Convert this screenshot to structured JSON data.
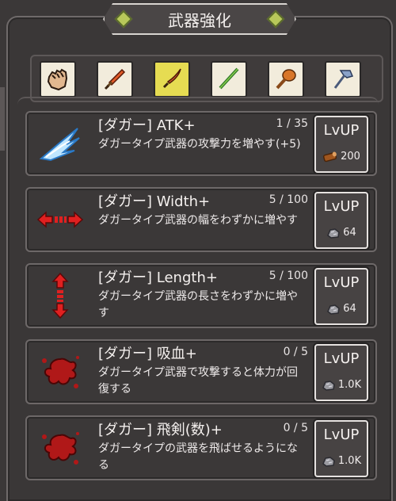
{
  "header": {
    "title": "武器強化"
  },
  "tabs": [
    {
      "icon": "fist-icon",
      "active": false
    },
    {
      "icon": "sword-icon",
      "active": false
    },
    {
      "icon": "dagger-icon",
      "active": true
    },
    {
      "icon": "spear-icon",
      "active": false
    },
    {
      "icon": "club-icon",
      "active": false
    },
    {
      "icon": "axe-icon",
      "active": false
    }
  ],
  "upgrades": [
    {
      "name": "[ダガー] ATK+",
      "level": "1 / 35",
      "desc": "ダガータイプ武器の攻撃力を増やす(+5)",
      "icon": "blue-slash-icon",
      "button": "LvUP",
      "cost": "200",
      "cost_icon": "wood-log-icon"
    },
    {
      "name": "[ダガー] Width+",
      "level": "5 / 100",
      "desc": "ダガータイプ武器の幅をわずかに増やす",
      "icon": "horizontal-arrows-icon",
      "button": "LvUP",
      "cost": "64",
      "cost_icon": "ore-icon"
    },
    {
      "name": "[ダガー] Length+",
      "level": "5 / 100",
      "desc": "ダガータイプ武器の長さをわずかに増やす",
      "icon": "vertical-arrows-icon",
      "button": "LvUP",
      "cost": "64",
      "cost_icon": "ore-icon"
    },
    {
      "name": "[ダガー] 吸血+",
      "level": "0 / 5",
      "desc": "ダガータイプ武器で攻撃すると体力が回復する",
      "icon": "blood-splat-icon",
      "button": "LvUP",
      "cost": "1.0K",
      "cost_icon": "ore-icon"
    },
    {
      "name": "[ダガー] 飛剣(数)+",
      "level": "0 / 5",
      "desc": "ダガータイプの武器を飛ばせるようになる",
      "icon": "blood-splat-icon",
      "button": "LvUP",
      "cost": "1.0K",
      "cost_icon": "ore-icon"
    }
  ]
}
